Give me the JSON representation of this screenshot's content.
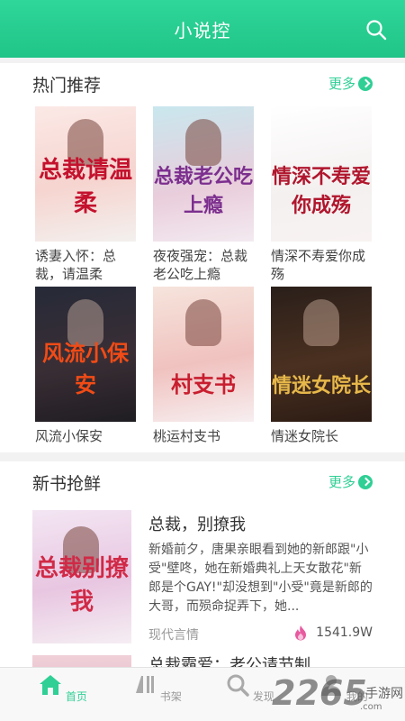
{
  "header": {
    "title": "小说控"
  },
  "hot": {
    "heading": "热门推荐",
    "more": "更多",
    "books": [
      {
        "name": "诱妻入怀：总裁，请温柔",
        "cover_title": "总裁请温柔"
      },
      {
        "name": "夜夜强宠：总裁老公吃上瘾",
        "cover_title": "总裁老公吃上瘾"
      },
      {
        "name": "情深不寿爱你成殇",
        "cover_title": "情深不寿爱你成殇"
      },
      {
        "name": "风流小保安",
        "cover_title": "风流小保安"
      },
      {
        "name": "桃运村支书",
        "cover_title": "村支书"
      },
      {
        "name": "情迷女院长",
        "cover_title": "情迷女院长"
      }
    ]
  },
  "new_books": {
    "heading": "新书抢鲜",
    "more": "更多",
    "featured": {
      "title": "总裁，别撩我",
      "cover_title": "总裁别撩我",
      "description": "新婚前夕，唐果亲眼看到她的新郎跟\"小受\"壁咚，她在新婚典礼上天女散花\"新郎是个GAY!\"却没想到\"小受\"竟是新郎的大哥，而殒命捉弄下，她...",
      "category": "现代言情",
      "heat": "1541.9W"
    },
    "next_title": "总裁霸爱：老公请节制"
  },
  "tabs": [
    {
      "label": "首页",
      "icon": "home-icon",
      "active": true
    },
    {
      "label": "书架",
      "icon": "bookshelf-icon",
      "active": false
    },
    {
      "label": "发现",
      "icon": "discover-icon",
      "active": false
    },
    {
      "label": "我的",
      "icon": "profile-icon",
      "active": false
    }
  ],
  "watermark": {
    "number": "2265",
    "text": "手游网",
    "url": ".com"
  },
  "colors": {
    "accent": "#2fcf95",
    "header": "#20c487",
    "heat": "#e85aa0"
  }
}
